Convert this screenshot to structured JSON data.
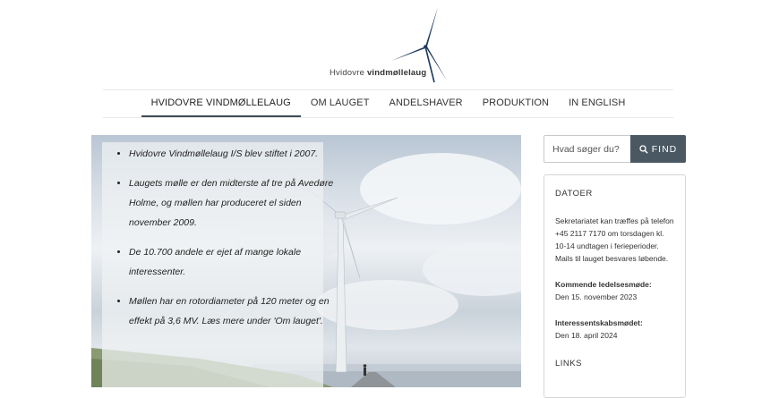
{
  "logo": {
    "text_light": "Hvidovre ",
    "text_bold": "vindmøllelaug"
  },
  "nav": {
    "items": [
      {
        "label": "HVIDOVRE VINDMØLLELAUG",
        "active": true
      },
      {
        "label": "OM LAUGET"
      },
      {
        "label": "ANDELSHAVER"
      },
      {
        "label": "PRODUKTION"
      },
      {
        "label": "IN ENGLISH"
      }
    ]
  },
  "hero": {
    "bullets": [
      "Hvidovre Vindmøllelaug I/S blev stiftet i 2007.",
      "Laugets mølle er den midterste af tre på Avedøre Holme, og møllen har produceret el siden november 2009.",
      "De 10.700 andele er ejet af mange lokale interessenter.",
      "Møllen har en rotordiameter på 120 meter og en effekt på 3,6 MV. Læs mere under 'Om lauget'."
    ]
  },
  "search": {
    "placeholder": "Hvad søger du?",
    "button_label": "FIND",
    "icon": "search-icon"
  },
  "sidebar": {
    "title": "DATOER",
    "info": "Sekretariatet kan træffes på telefon +45 2117 7170 om torsdagen kl. 10-14 undtagen i ferieperioder. Mails til lauget besvares løbende.",
    "meeting_label": "Kommende ledelsesmøde:",
    "meeting_date": "Den 15. november 2023",
    "interest_label": "Interessentskabsmødet:",
    "interest_date": "Den 18. april 2024",
    "links_title": "LINKS"
  },
  "colors": {
    "accent": "#4a5864",
    "nav_underline": "#3d4c5a",
    "logo_blue": "#1e3a5f"
  }
}
